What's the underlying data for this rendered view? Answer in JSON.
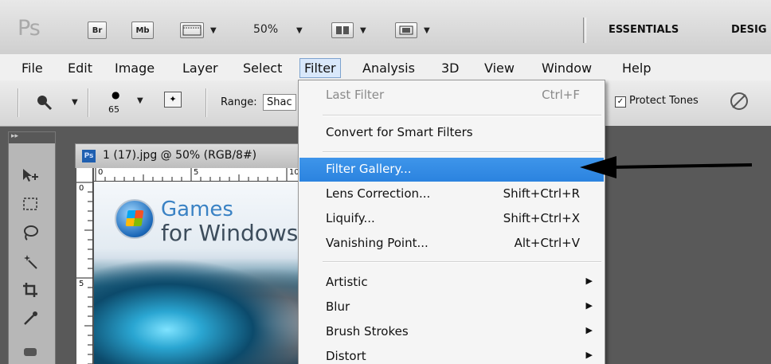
{
  "app": {
    "logo": "Ps",
    "bridge_label": "Br",
    "minibridge_label": "Mb",
    "zoom_value": "50%",
    "workspaces": [
      "ESSENTIALS",
      "DESIG"
    ]
  },
  "menubar": {
    "items": [
      "File",
      "Edit",
      "Image",
      "Layer",
      "Select",
      "Filter",
      "Analysis",
      "3D",
      "View",
      "Window",
      "Help"
    ]
  },
  "options": {
    "brush_size": "65",
    "range_label": "Range:",
    "range_value": "Shac",
    "protect_tones": "Protect Tones"
  },
  "document": {
    "tab_icon": "Ps",
    "title": "1 (17).jpg @ 50% (RGB/8#)",
    "ruler_h": [
      "0",
      "5",
      "10"
    ],
    "ruler_v": [
      "0",
      "5"
    ],
    "brand_line1": "Games",
    "brand_line2": "for Windows"
  },
  "filter_menu": {
    "last_filter": {
      "label": "Last Filter",
      "shortcut": "Ctrl+F"
    },
    "convert": {
      "label": "Convert for Smart Filters"
    },
    "group1": [
      {
        "label": "Filter Gallery...",
        "shortcut": ""
      },
      {
        "label": "Lens Correction...",
        "shortcut": "Shift+Ctrl+R"
      },
      {
        "label": "Liquify...",
        "shortcut": "Shift+Ctrl+X"
      },
      {
        "label": "Vanishing Point...",
        "shortcut": "Alt+Ctrl+V"
      }
    ],
    "submenus": [
      "Artistic",
      "Blur",
      "Brush Strokes",
      "Distort"
    ]
  },
  "colors": {
    "highlight": "#2b83df",
    "menu_bg": "#f5f5f5",
    "workspace_bg": "#595959"
  },
  "icons": [
    "zoom-icon",
    "brush-icon",
    "mode-icon",
    "move-tool-icon",
    "marquee-tool-icon",
    "lasso-tool-icon",
    "magic-wand-icon",
    "crop-tool-icon",
    "eyedropper-icon",
    "target-icon",
    "arrow-pointer-icon"
  ]
}
